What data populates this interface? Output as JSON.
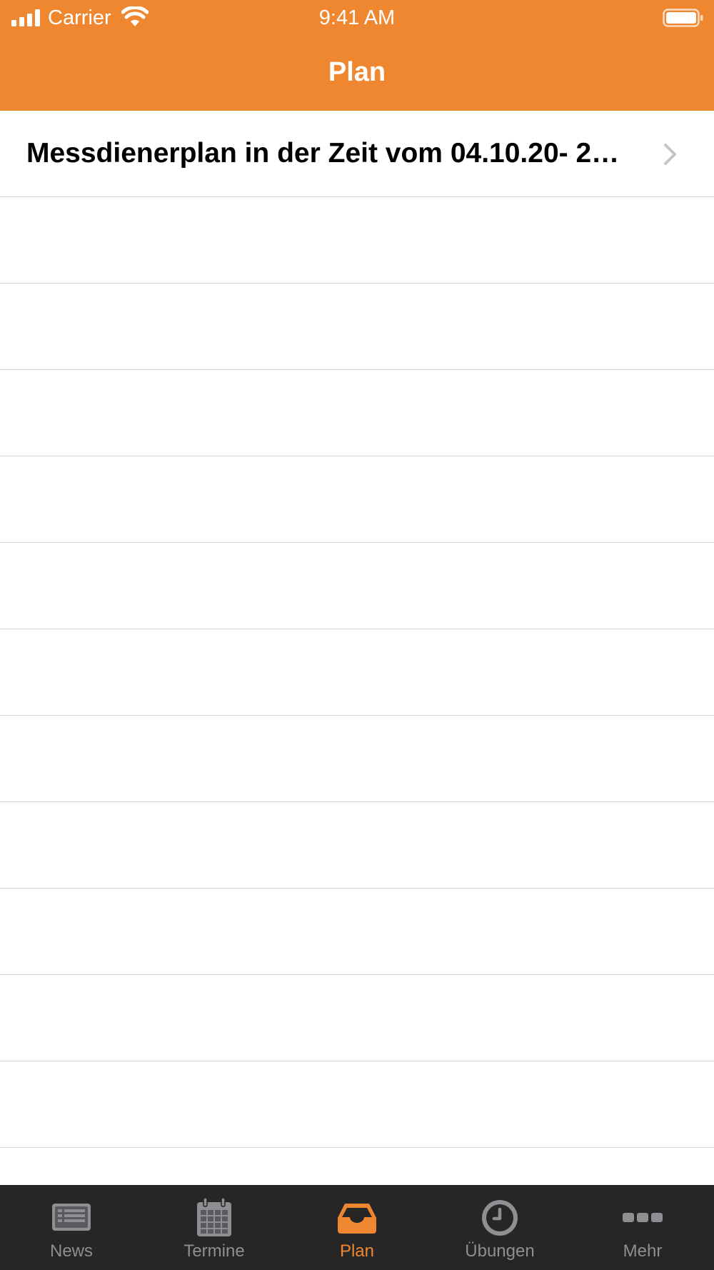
{
  "colors": {
    "accent": "#EF8731",
    "tab_bar_bg": "#262626",
    "tab_inactive": "#8e8e93",
    "separator": "#d6d6d9"
  },
  "status_bar": {
    "carrier": "Carrier",
    "time": "9:41 AM",
    "icons": [
      "cellular-signal-icon",
      "wifi-icon",
      "battery-icon"
    ]
  },
  "nav": {
    "title": "Plan"
  },
  "list": {
    "items": [
      {
        "title": "Messdienerplan in der Zeit vom 04.10.20- 2…",
        "icon": "chevron-right-icon"
      }
    ]
  },
  "tabbar": {
    "tabs": [
      {
        "label": "News",
        "icon": "news-icon",
        "active": false
      },
      {
        "label": "Termine",
        "icon": "calendar-icon",
        "active": false
      },
      {
        "label": "Plan",
        "icon": "inbox-tray-icon",
        "active": true
      },
      {
        "label": "Übungen",
        "icon": "clock-icon",
        "active": false
      },
      {
        "label": "Mehr",
        "icon": "more-dots-icon",
        "active": false
      }
    ]
  }
}
